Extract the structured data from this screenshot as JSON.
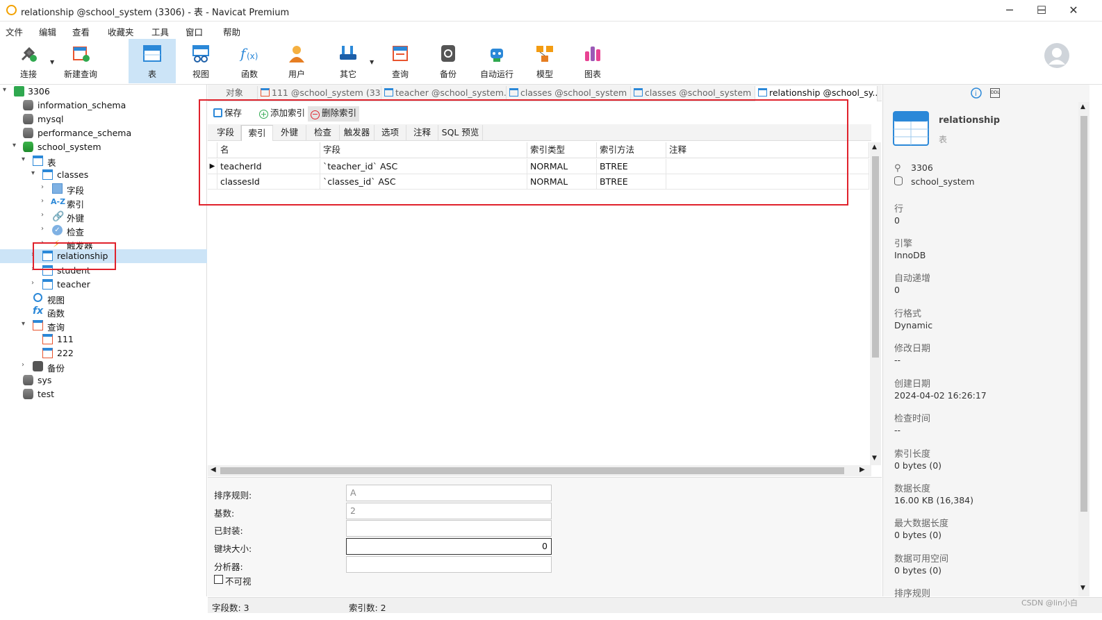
{
  "window": {
    "title": "relationship @school_system (3306) - 表 - Navicat Premium",
    "min": "─",
    "max": "☐",
    "close": "✕"
  },
  "menu": [
    "文件",
    "编辑",
    "查看",
    "收藏夹",
    "工具",
    "窗口",
    "帮助"
  ],
  "toolbar": {
    "connect": "连接",
    "new_query": "新建查询",
    "table": "表",
    "view": "视图",
    "function": "函数",
    "user": "用户",
    "other": "其它",
    "query": "查询",
    "backup": "备份",
    "automation": "自动运行",
    "model": "模型",
    "chart": "图表"
  },
  "tree": {
    "conn": "3306",
    "db1": "information_schema",
    "db2": "mysql",
    "db3": "performance_schema",
    "db4": "school_system",
    "tables": "表",
    "classes": "classes",
    "fields": "字段",
    "indexes": "索引",
    "fks": "外键",
    "checks": "检查",
    "triggers": "触发器",
    "relationship": "relationship",
    "student": "student",
    "teacher": "teacher",
    "views": "视图",
    "functions": "函数",
    "queries": "查询",
    "q1": "111",
    "q2": "222",
    "backups": "备份",
    "db5": "sys",
    "db6": "test"
  },
  "tabs": {
    "objects": "对象",
    "t1": "111 @school_system (33...",
    "t2": "teacher @school_system...",
    "t3": "classes @school_system ...",
    "t4": "classes @school_system ...",
    "t5": "relationship @school_sy..."
  },
  "editor": {
    "save": "保存",
    "add_index": "添加索引",
    "delete_index": "删除索引",
    "subtabs": [
      "字段",
      "索引",
      "外键",
      "检查",
      "触发器",
      "选项",
      "注释",
      "SQL 预览"
    ]
  },
  "grid": {
    "headers": [
      "名",
      "字段",
      "索引类型",
      "索引方法",
      "注释"
    ],
    "rows": [
      [
        "teacherId",
        "`teacher_id` ASC",
        "NORMAL",
        "BTREE",
        ""
      ],
      [
        "classesId",
        "`classes_id` ASC",
        "NORMAL",
        "BTREE",
        ""
      ]
    ]
  },
  "props": {
    "collation_label": "排序规则:",
    "collation_value": "A",
    "cardinality_label": "基数:",
    "cardinality_value": "2",
    "packed_label": "已封装:",
    "packed_value": "",
    "key_block_label": "键块大小:",
    "key_block_value": "0",
    "parser_label": "分析器:",
    "parser_value": "",
    "invisible_label": "不可视"
  },
  "status": {
    "fields": "字段数: 3",
    "indexes": "索引数: 2"
  },
  "right": {
    "name": "relationship",
    "type": "表",
    "conn": "3306",
    "db": "school_system",
    "rows_label": "行",
    "rows_value": "0",
    "engine_label": "引擎",
    "engine_value": "InnoDB",
    "autoinc_label": "自动递增",
    "autoinc_value": "0",
    "rowformat_label": "行格式",
    "rowformat_value": "Dynamic",
    "modified_label": "修改日期",
    "modified_value": "--",
    "created_label": "创建日期",
    "created_value": "2024-04-02 16:26:17",
    "checked_label": "检查时间",
    "checked_value": "--",
    "indexlen_label": "索引长度",
    "indexlen_value": "0 bytes (0)",
    "datalen_label": "数据长度",
    "datalen_value": "16.00 KB (16,384)",
    "maxdata_label": "最大数据长度",
    "maxdata_value": "0 bytes (0)",
    "free_label": "数据可用空间",
    "free_value": "0 bytes (0)",
    "collation_label": "排序规则"
  },
  "watermark": "CSDN @lin小白"
}
